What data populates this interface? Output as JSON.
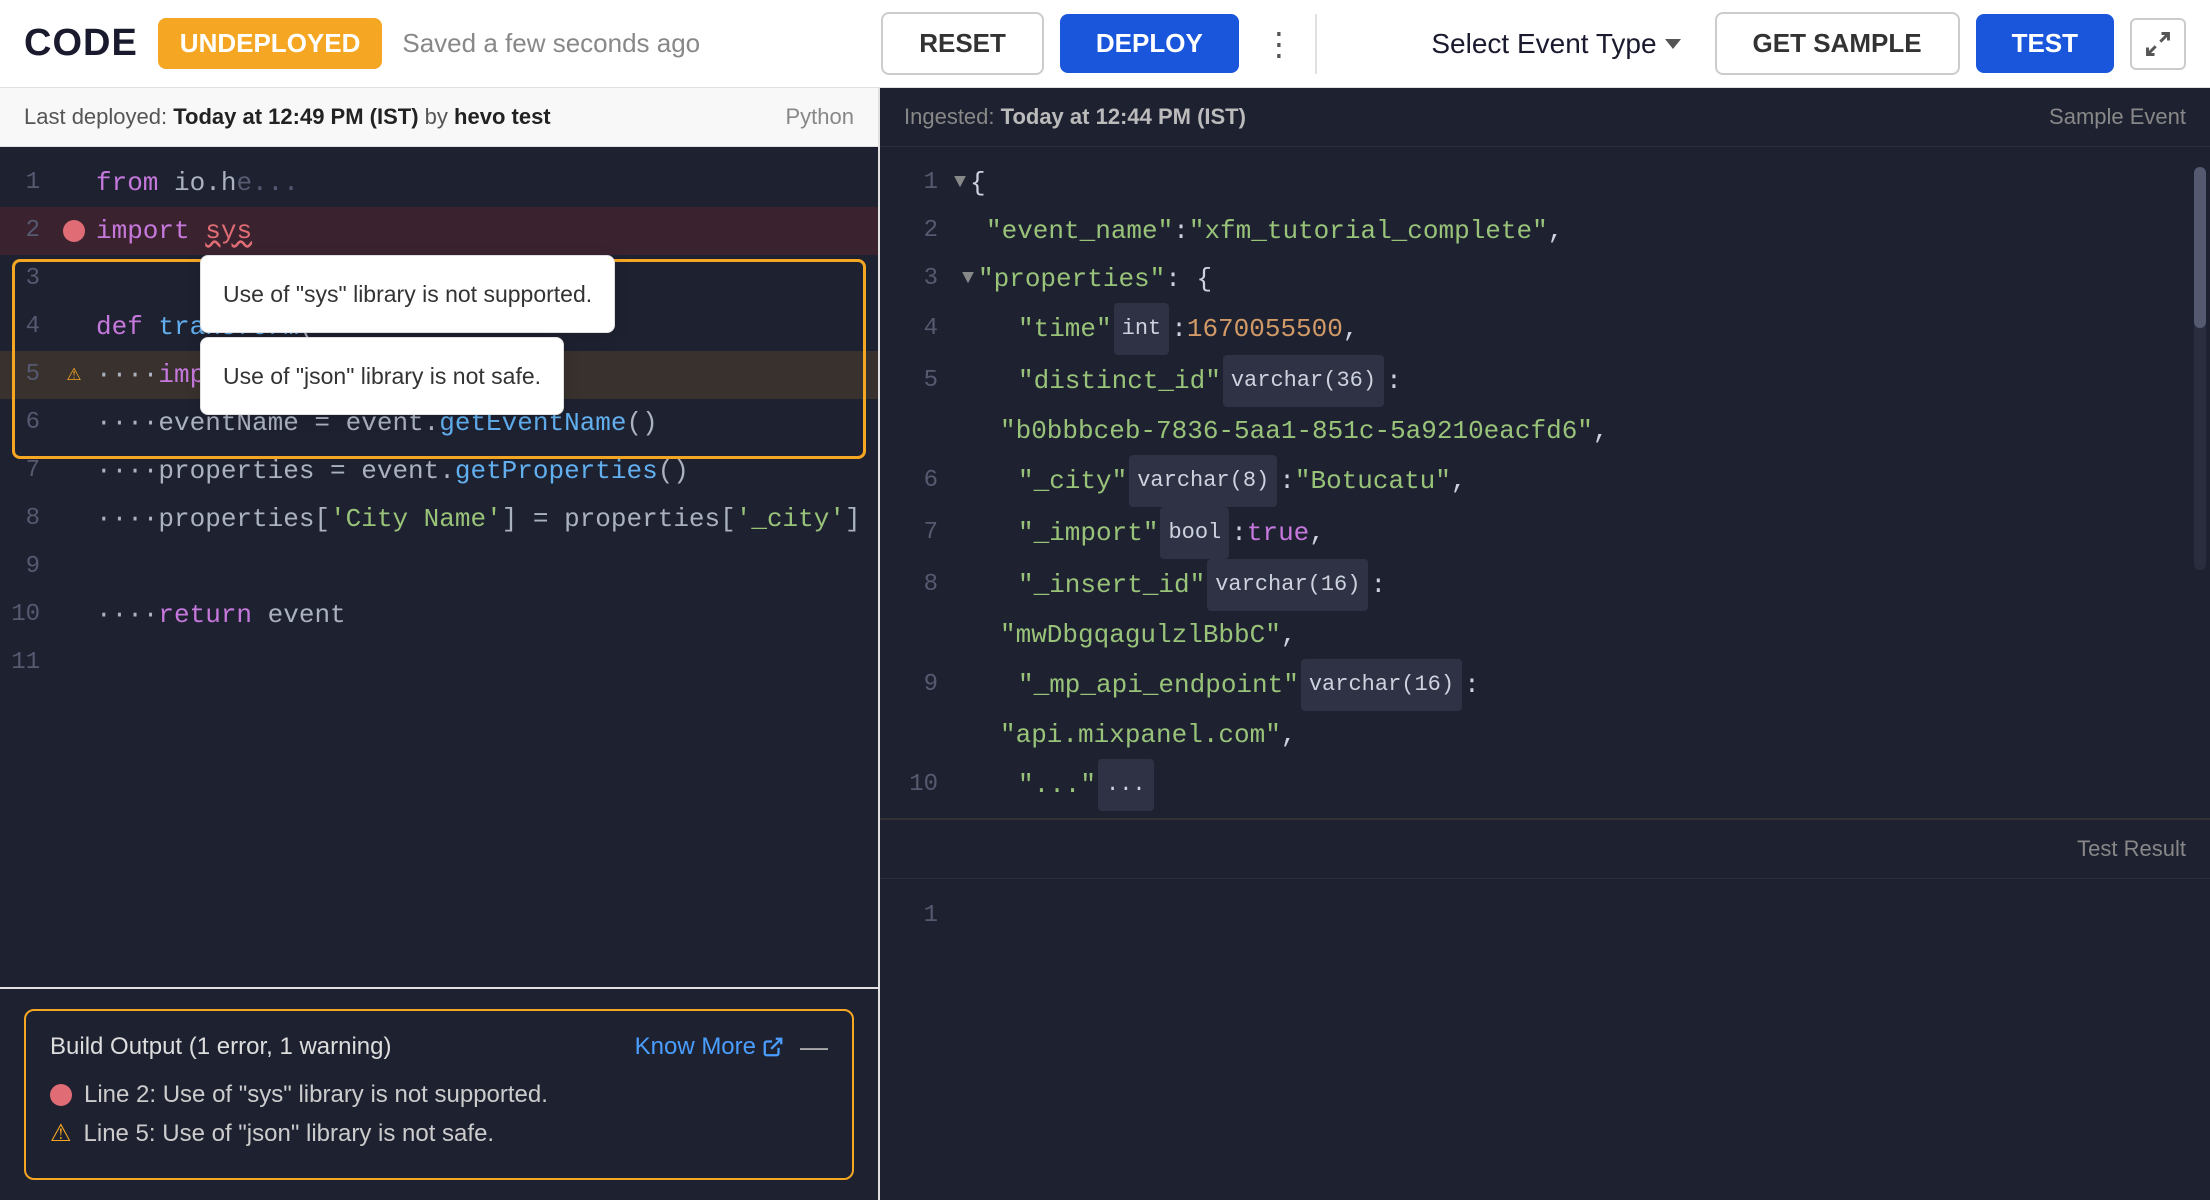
{
  "topbar": {
    "code_label": "CODE",
    "status_badge": "UNDEPLOYED",
    "saved_text": "Saved a few seconds ago",
    "reset_label": "RESET",
    "deploy_label": "DEPLOY",
    "select_event_type": "Select Event Type",
    "get_sample_label": "GET SAMPLE",
    "test_label": "TEST"
  },
  "left_panel": {
    "meta_prefix": "Last deployed:",
    "meta_datetime": "Today at 12:49 PM (IST)",
    "meta_by": "by",
    "meta_user": "hevo test",
    "lang_label": "Python",
    "lines": [
      {
        "num": 1,
        "content": "from io.hevo",
        "type": "normal",
        "parts": [
          {
            "t": "kw",
            "v": "from"
          },
          {
            "t": "text",
            "v": " io.h"
          },
          {
            "t": "fade",
            "v": "e..."
          }
        ]
      },
      {
        "num": 2,
        "content": "import sys",
        "type": "error",
        "has_icon": "error"
      },
      {
        "num": 3,
        "content": "",
        "type": "normal"
      },
      {
        "num": 4,
        "content": "def transform(",
        "type": "normal"
      },
      {
        "num": 5,
        "content": "    import json",
        "type": "warn",
        "has_icon": "warn"
      },
      {
        "num": 6,
        "content": "    eventName = event.getEventName()",
        "type": "normal"
      },
      {
        "num": 7,
        "content": "    properties = event.getProperties()",
        "type": "normal"
      },
      {
        "num": 8,
        "content": "    properties['City Name'] = properties['_city']",
        "type": "normal"
      },
      {
        "num": 9,
        "content": "",
        "type": "normal"
      },
      {
        "num": 10,
        "content": "    return event",
        "type": "normal"
      },
      {
        "num": 11,
        "content": "",
        "type": "normal"
      }
    ],
    "tooltip_sys": "Use of \"sys\" library is not supported.",
    "tooltip_json": "Use of \"json\" library is not safe.",
    "build_output": {
      "title": "Build Output (1 error, 1 warning)",
      "know_more": "Know More",
      "error_line": "Line 2: Use of \"sys\" library is not supported.",
      "warn_line": "Line 5: Use of \"json\" library is not safe."
    }
  },
  "right_panel": {
    "ingested_prefix": "Ingested:",
    "ingested_time": "Today at 12:44 PM (IST)",
    "sample_label": "Sample Event",
    "test_result_label": "Test Result",
    "json_lines": [
      {
        "num": 1,
        "content": "{",
        "indent": 0
      },
      {
        "num": 2,
        "content": "  \"event_name\": \"xfm_tutorial_complete\",",
        "indent": 2
      },
      {
        "num": 3,
        "content": "  \"properties\": {",
        "indent": 2
      },
      {
        "num": 4,
        "content": "    \"time\" int : 1670055500,",
        "indent": 4
      },
      {
        "num": 5,
        "content": "    \"distinct_id\" varchar(36) : \"b0bbbceb-7836-5aa1-851c-5a9210eacfd6\",",
        "indent": 4
      },
      {
        "num": 6,
        "content": "    \"_city\" varchar(8) : \"Botucatu\",",
        "indent": 4
      },
      {
        "num": 7,
        "content": "    \"_import\" bool : true,",
        "indent": 4
      },
      {
        "num": 8,
        "content": "    \"_insert_id\" varchar(16) : \"mwDbgqagulzlBbbC\",",
        "indent": 4
      },
      {
        "num": 9,
        "content": "    \"_mp_api_endpoint\" varchar(16) : \"api.mixpanel.com\",",
        "indent": 4
      },
      {
        "num": 10,
        "content": "    \"...\"",
        "indent": 4
      }
    ]
  }
}
